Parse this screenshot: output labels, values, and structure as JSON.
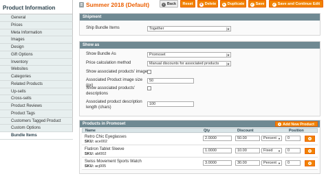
{
  "sidebar": {
    "title": "Product Information",
    "items": [
      {
        "label": "General"
      },
      {
        "label": "Prices"
      },
      {
        "label": "Meta Information"
      },
      {
        "label": "Images"
      },
      {
        "label": "Design"
      },
      {
        "label": "Gift Options"
      },
      {
        "label": "Inventory"
      },
      {
        "label": "Websites"
      },
      {
        "label": "Categories"
      },
      {
        "label": "Related Products"
      },
      {
        "label": "Up-sells"
      },
      {
        "label": "Cross-sells"
      },
      {
        "label": "Product Reviews"
      },
      {
        "label": "Product Tags"
      },
      {
        "label": "Customers Tagged Product"
      },
      {
        "label": "Custom Options"
      },
      {
        "label": "Bundle Items",
        "active": true
      }
    ]
  },
  "header": {
    "title": "Summer 2018 (Default)",
    "buttons": {
      "back": "Back",
      "reset": "Reset",
      "delete": "Delete",
      "duplicate": "Duplicate",
      "save": "Save",
      "save_continue": "Save and Continue Edit"
    }
  },
  "shipment": {
    "title": "Shipment",
    "ship_label": "Ship Bundle Items",
    "ship_value": "Together"
  },
  "show_as": {
    "title": "Show as",
    "show_bundle_label": "Show Bundle As",
    "show_bundle_value": "Promoset",
    "price_calc_label": "Price calculation method",
    "price_calc_value": "Manual discounts for associated products",
    "show_images_label": "Show associated products' images",
    "image_size_label": "Associated Product image size (px)",
    "image_size_value": "50",
    "show_desc_label": "Show associated products' descriptions",
    "desc_length_label": "Associated product description length (chars)",
    "desc_length_value": "100"
  },
  "products": {
    "title": "Products in Promoset",
    "add_button": "Add New Product",
    "columns": {
      "name": "Name",
      "qty": "Qty",
      "discount": "Discount",
      "position": "Position"
    },
    "sku_prefix": "SKU:",
    "rows": [
      {
        "name": "Retro Chic Eyeglasses",
        "sku": "ace002",
        "qty": "2.0000",
        "discount": "50.00",
        "discount_type": "Percent",
        "position": "0"
      },
      {
        "name": "Flatiron Tablet Sleeve",
        "sku": "abl002",
        "qty": "1.0000",
        "discount": "10.00",
        "discount_type": "Fixed",
        "position": "0"
      },
      {
        "name": "Swiss Movement Sports Watch",
        "sku": "acj005",
        "qty": "3.0000",
        "discount": "30.00",
        "discount_type": "Percent",
        "position": "0"
      }
    ]
  },
  "colors": {
    "accent": "#f18200",
    "title_orange": "#eb5e00",
    "section_header": "#6f8992",
    "sidebar_bg": "#e7efef"
  }
}
